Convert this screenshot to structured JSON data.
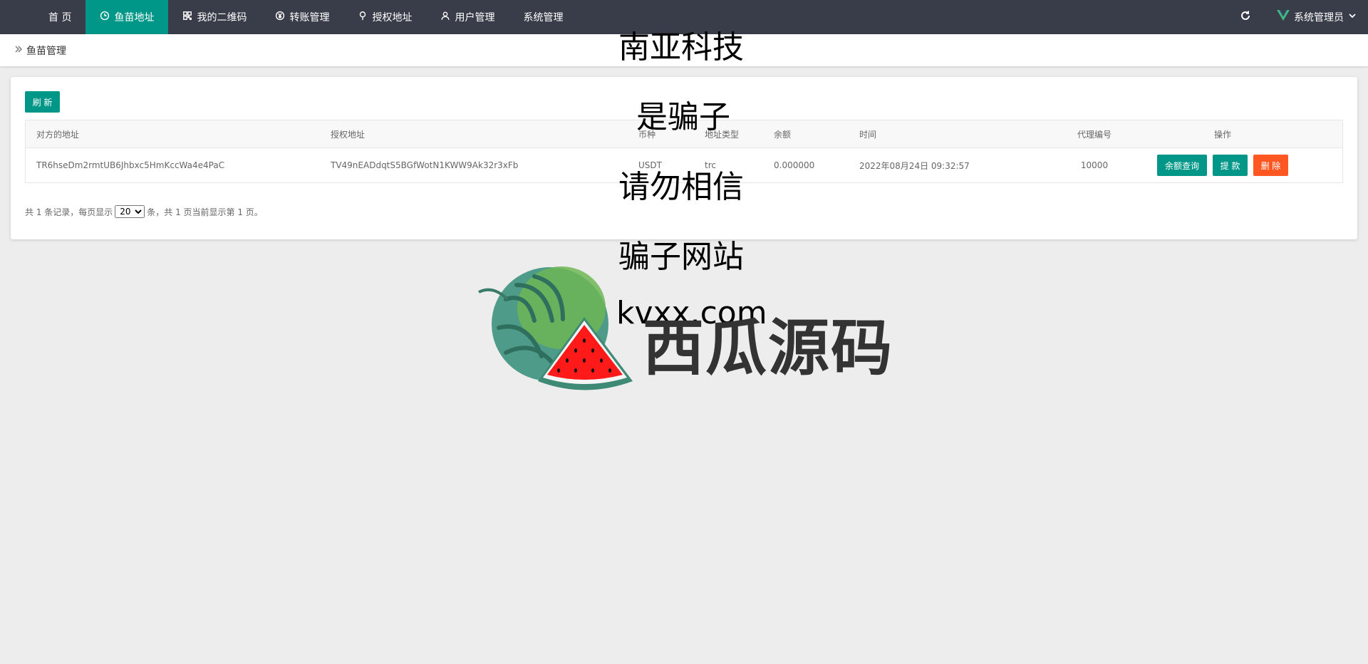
{
  "nav": {
    "items": [
      {
        "label": "首 页",
        "icon": "none"
      },
      {
        "label": "鱼苗地址",
        "icon": "clock-icon",
        "active": true
      },
      {
        "label": "我的二维码",
        "icon": "qrcode-icon"
      },
      {
        "label": "转账管理",
        "icon": "yen-icon"
      },
      {
        "label": "授权地址",
        "icon": "location-pin-icon"
      },
      {
        "label": "用户管理",
        "icon": "user-icon"
      },
      {
        "label": "系统管理",
        "icon": "none"
      }
    ],
    "user_label": "系统管理员"
  },
  "breadcrumb": {
    "label": "鱼苗管理"
  },
  "card": {
    "refresh_label": "刷 新",
    "table": {
      "headers": [
        "对方的地址",
        "授权地址",
        "币种",
        "地址类型",
        "余额",
        "时间",
        "代理编号",
        "操作"
      ],
      "rows": [
        {
          "peer_address": "TR6hseDm2rmtUB6Jhbxc5HmKccWa4e4PaC",
          "auth_address": "TV49nEADdqtS5BGfWotN1KWW9Ak32r3xFb",
          "currency": "USDT",
          "address_type": "trc",
          "balance": "0.000000",
          "time": "2022年08月24日 09:32:57",
          "agent_id": "10000",
          "actions": {
            "query": "余额查询",
            "withdraw": "提 款",
            "delete": "删 除"
          }
        }
      ]
    },
    "pager": {
      "prefix": "共 1 条记录，每页显示",
      "page_size": "20",
      "suffix": "条，共 1 页当前显示第 1 页。"
    }
  },
  "overlay": {
    "lines": [
      "南亚科技",
      "是骗子",
      "请勿相信",
      "骗子网站",
      "kvxx.com"
    ],
    "brand": "西瓜源码"
  },
  "colors": {
    "topbar": "#393d49",
    "accent": "#009688",
    "danger": "#ff5722",
    "background": "#ededed"
  }
}
